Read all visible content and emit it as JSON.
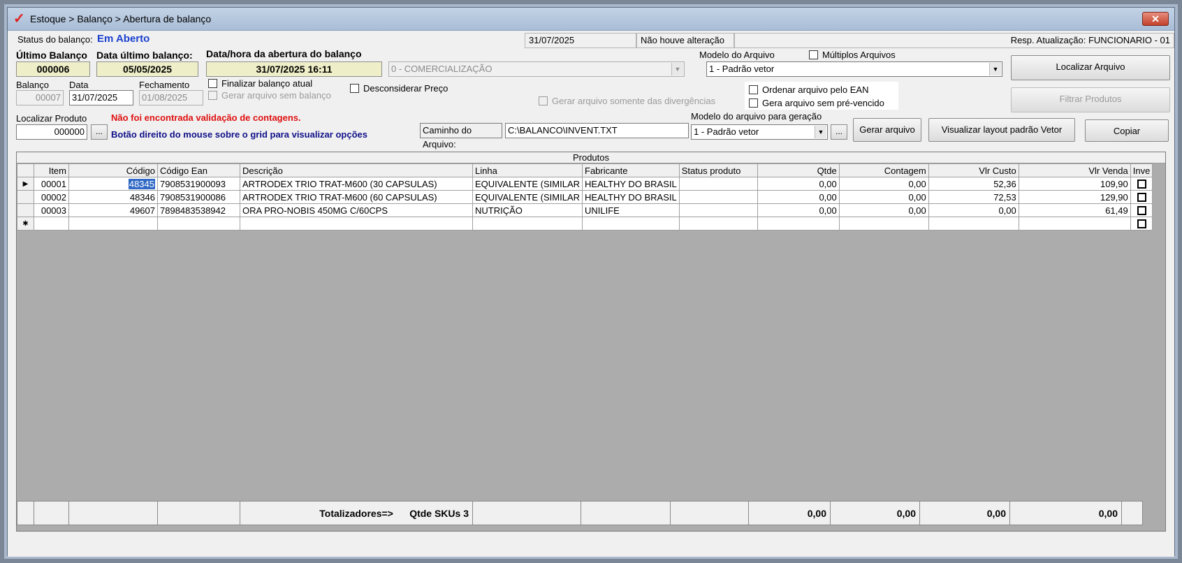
{
  "window": {
    "title": "Estoque > Balanço > Abertura de balanço",
    "close_label": "✕"
  },
  "status_bar": {
    "status_label": "Status do balanço:",
    "status_value": "Em Aberto",
    "date": "31/07/2025",
    "change_status": "Não houve alteração",
    "resp_label": "Resp. Atualização: FUNCIONARIO - 01"
  },
  "header": {
    "ultimo_balanco_label": "Último Balanço",
    "ultimo_balanco_value": "000006",
    "data_ultimo_label": "Data último balanço:",
    "data_ultimo_value": "05/05/2025",
    "abertura_label": "Data/hora da abertura do balanço",
    "abertura_value": "31/07/2025 16:11",
    "comercializacao_value": "0 - COMERCIALIZAÇÃO",
    "modelo_arquivo_label": "Modelo do Arquivo",
    "modelo_arquivo_value": "1 - Padrão vetor",
    "multiplos_label": "Múltiplos Arquivos",
    "localizar_arquivo_btn": "Localizar Arquivo",
    "filtrar_produtos_btn": "Filtrar Produtos"
  },
  "balanco_fields": {
    "balanco_label": "Balanço",
    "balanco_value": "00007",
    "data_label": "Data",
    "data_value": "31/07/2025",
    "fechamento_label": "Fechamento",
    "fechamento_value": "01/08/2025",
    "finalizar_label": "Finalizar balanço atual",
    "gerar_sem_balanco_label": "Gerar arquivo sem balanço",
    "desconsiderar_label": "Desconsiderar Preço",
    "gerar_divergencias_label": "Gerar arquivo somente das divergências",
    "ordenar_ean_label": "Ordenar arquivo pelo EAN",
    "gera_sem_prevencido_label": "Gera arquivo sem pré-vencido"
  },
  "locate": {
    "label": "Localizar Produto",
    "value": "000000",
    "dots": "...",
    "error_msg": "Não foi encontrada validação de contagens.",
    "hint_msg": "Botão direito do mouse sobre o grid para visualizar opções",
    "caminho_label": "Caminho do Arquivo:",
    "caminho_value": "C:\\BALANCO\\INVENT.TXT",
    "modelo_geracao_label": "Modelo do arquivo para geração",
    "modelo_geracao_value": "1 - Padrão vetor",
    "dots2": "...",
    "gerar_btn": "Gerar arquivo",
    "visualizar_btn": "Visualizar layout padrão Vetor",
    "copiar_btn": "Copiar"
  },
  "grid": {
    "caption": "Produtos",
    "headers": [
      "Item",
      "Código",
      "Código Ean",
      "Descrição",
      "Linha",
      "Fabricante",
      "Status produto",
      "Qtde",
      "Contagem",
      "Vlr Custo",
      "Vlr Venda",
      "Inve"
    ],
    "rows": [
      {
        "indicator": "▶",
        "item": "00001",
        "codigo": "48345",
        "ean": "7908531900093",
        "descricao": "ARTRODEX TRIO TRAT-M600 (30 CAPSULAS)",
        "linha": "EQUIVALENTE (SIMILAR",
        "fabricante": "HEALTHY DO BRASIL",
        "status": "",
        "qtde": "0,00",
        "contagem": "0,00",
        "custo": "52,36",
        "venda": "109,90"
      },
      {
        "indicator": "",
        "item": "00002",
        "codigo": "48346",
        "ean": "7908531900086",
        "descricao": "ARTRODEX TRIO TRAT-M600 (60 CAPSULAS)",
        "linha": "EQUIVALENTE (SIMILAR",
        "fabricante": "HEALTHY DO BRASIL",
        "status": "",
        "qtde": "0,00",
        "contagem": "0,00",
        "custo": "72,53",
        "venda": "129,90"
      },
      {
        "indicator": "",
        "item": "00003",
        "codigo": "49607",
        "ean": "7898483538942",
        "descricao": "ORA PRO-NOBIS 450MG C/60CPS",
        "linha": "NUTRIÇÃO",
        "fabricante": "UNILIFE",
        "status": "",
        "qtde": "0,00",
        "contagem": "0,00",
        "custo": "0,00",
        "venda": "61,49"
      }
    ],
    "new_row_indicator": "✱"
  },
  "totals": {
    "label": "Totalizadores=>",
    "skus": "Qtde SKUs 3",
    "qtde": "0,00",
    "contagem": "0,00",
    "custo": "0,00",
    "venda": "0,00"
  }
}
